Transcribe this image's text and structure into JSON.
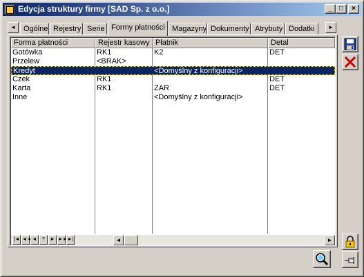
{
  "window": {
    "title": "Edycja struktury firmy [SAD Sp. z o.o.]",
    "controls": {
      "minimize": "_",
      "maximize": "□",
      "close": "×"
    }
  },
  "tabs": [
    {
      "label": "Ogólne",
      "active": false
    },
    {
      "label": "Rejestry",
      "active": false
    },
    {
      "label": "Serie",
      "active": false
    },
    {
      "label": "Formy płatności",
      "active": true
    },
    {
      "label": "Magazyny",
      "active": false
    },
    {
      "label": "Dokumenty",
      "active": false
    },
    {
      "label": "Atrybuty",
      "active": false
    },
    {
      "label": "Dodatki",
      "active": false
    }
  ],
  "tab_scroll": {
    "left": "◄",
    "right": "►"
  },
  "grid": {
    "columns": [
      "Forma płatności",
      "Rejestr kasowy",
      "Płatnik",
      "Detal"
    ],
    "rows": [
      [
        "Gotówka",
        "RK1",
        "K2",
        "DET"
      ],
      [
        "Przelew",
        "<BRAK>",
        "",
        ""
      ],
      [
        "Kredyt",
        "",
        "<Domyślny z konfiguracji>",
        ""
      ],
      [
        "Czek",
        "RK1",
        "",
        "DET"
      ],
      [
        "Karta",
        "RK1",
        "ZAR",
        "DET"
      ],
      [
        "Inne",
        "",
        "<Domyślny z konfiguracji>",
        ""
      ]
    ],
    "selected_row": 2
  },
  "record_nav": {
    "first": "|◄",
    "prev_page": "◄◄",
    "prev": "◄",
    "find": "?",
    "next": "►",
    "next_page": "►►",
    "last": "►|"
  },
  "hscroll": {
    "left": "◄",
    "right": "►"
  },
  "actions": {
    "save": "save-icon",
    "cancel": "cancel-icon",
    "lock": "lock-icon",
    "pin": "pin-icon",
    "search": "search-icon"
  }
}
